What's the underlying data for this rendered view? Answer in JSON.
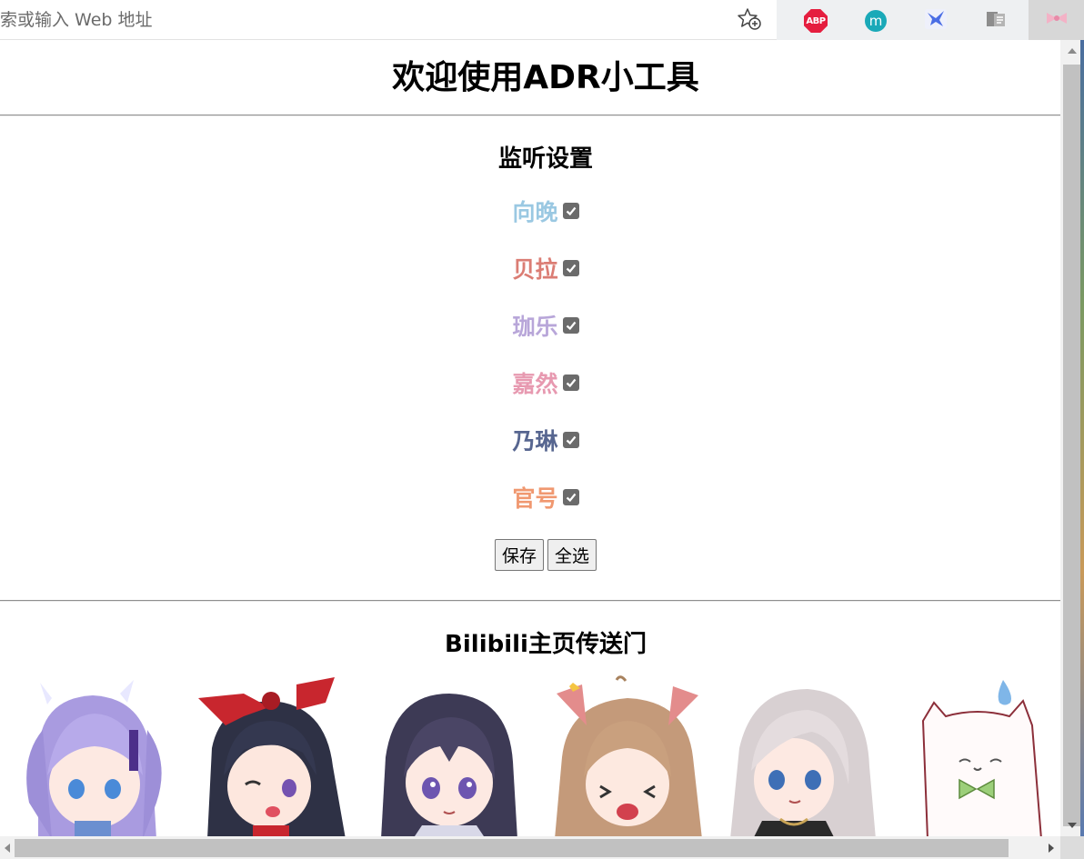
{
  "browser": {
    "address_placeholder": "索或输入 Web 地址",
    "extensions": {
      "abp_label": "ABP",
      "m_label": "m"
    }
  },
  "page": {
    "title": "欢迎使用ADR小工具",
    "listen_title": "监听设置",
    "members": [
      {
        "name": "向晚",
        "color": "#9ac8e2",
        "checked": true
      },
      {
        "name": "贝拉",
        "color": "#db7d74",
        "checked": true
      },
      {
        "name": "珈乐",
        "color": "#b8a6d9",
        "checked": true
      },
      {
        "name": "嘉然",
        "color": "#e799b0",
        "checked": true
      },
      {
        "name": "乃琳",
        "color": "#576690",
        "checked": true
      },
      {
        "name": "官号",
        "color": "#f09870",
        "checked": true
      }
    ],
    "buttons": {
      "save_label": "保存",
      "select_all_label": "全选"
    },
    "bili_title": "Bilibili主页传送门",
    "avatars": [
      "向晚",
      "贝拉",
      "珈乐",
      "嘉然",
      "乃琳",
      "官号"
    ]
  }
}
